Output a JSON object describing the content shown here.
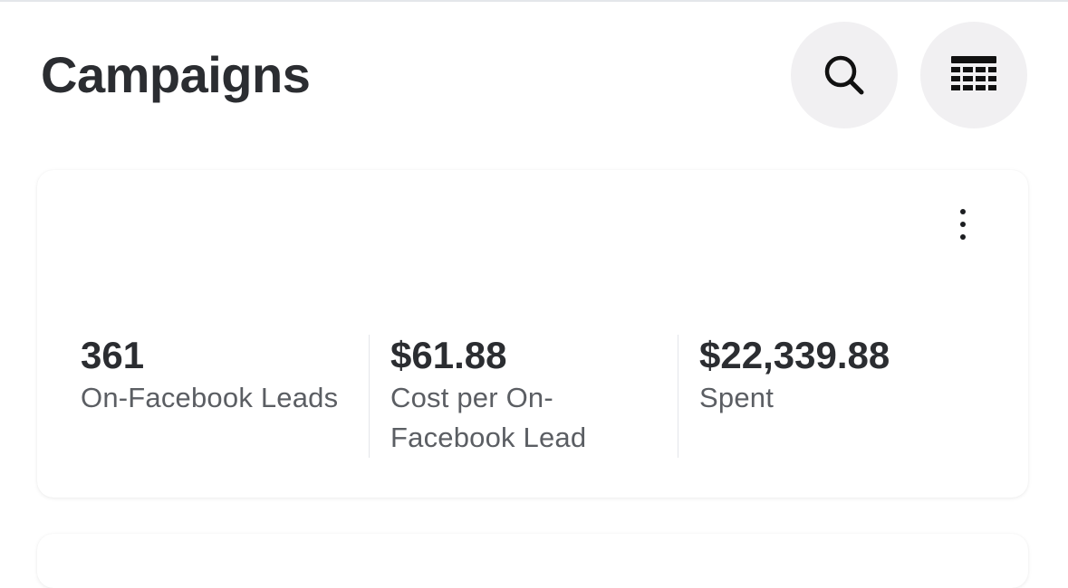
{
  "header": {
    "title": "Campaigns",
    "search_icon": "search-icon",
    "columns_icon": "table-columns-icon"
  },
  "campaign_card": {
    "more_icon": "more-vertical-icon",
    "metrics": [
      {
        "value": "361",
        "label": "On-Facebook Leads"
      },
      {
        "value": "$61.88",
        "label": "Cost per On-Facebook Lead"
      },
      {
        "value": "$22,339.88",
        "label": "Spent"
      }
    ]
  },
  "colors": {
    "text_primary": "#2b2d31",
    "text_secondary": "#5b5e63",
    "icon_button_bg": "#f1f0f2"
  }
}
